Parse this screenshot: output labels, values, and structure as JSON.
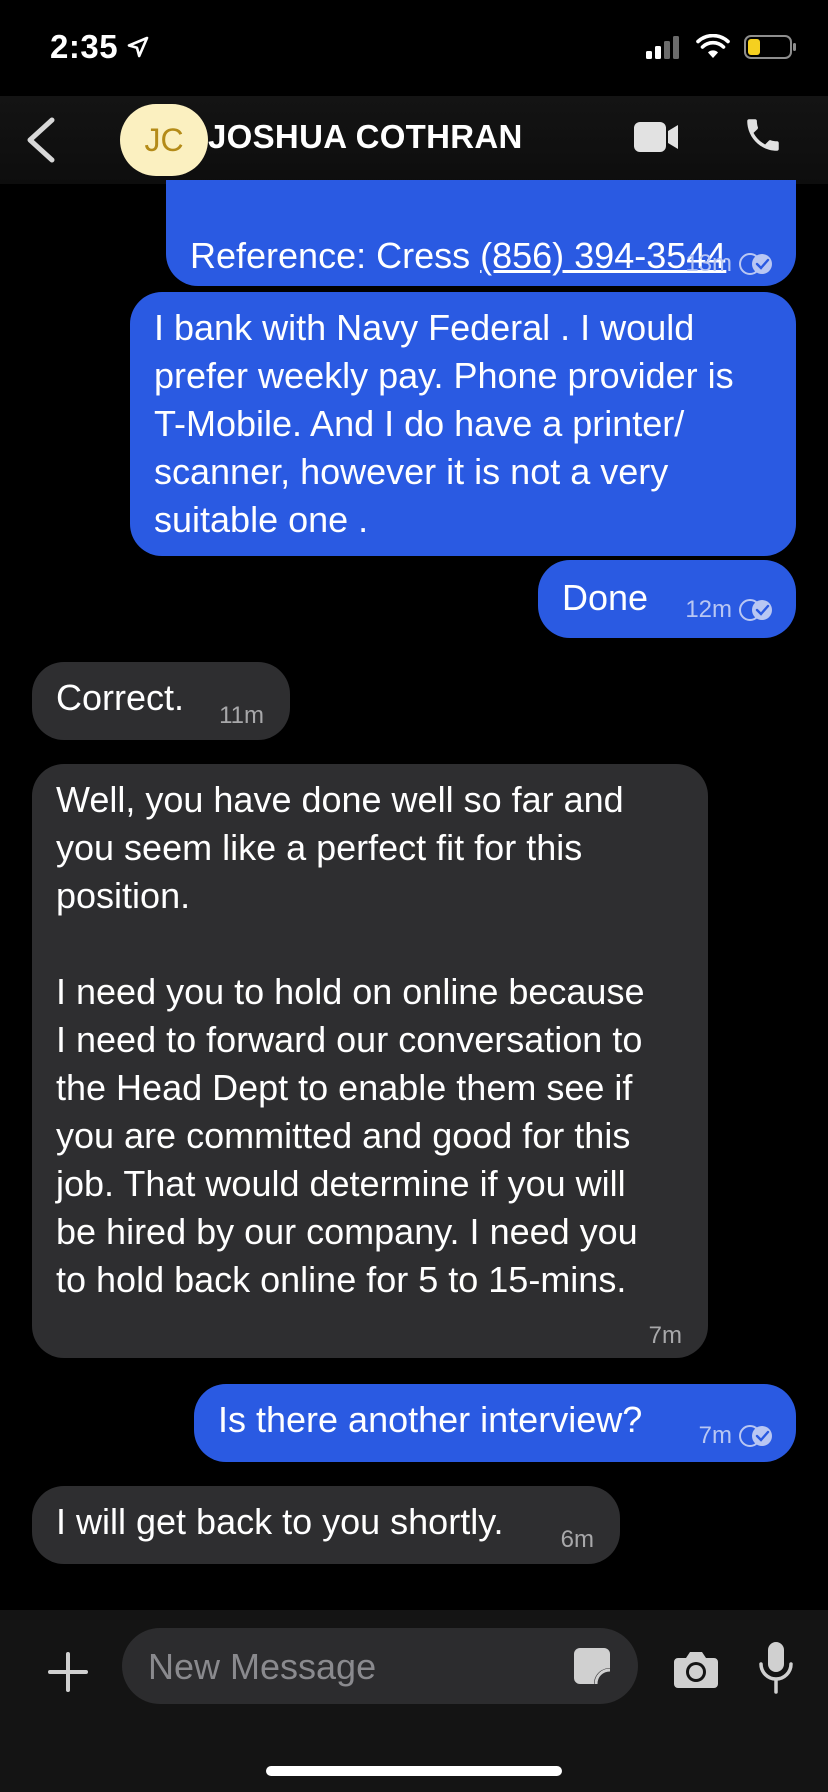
{
  "status_bar": {
    "time": "2:35"
  },
  "header": {
    "avatar_initials": "JC",
    "contact_name": "JOSHUA COTHRAN"
  },
  "messages": [
    {
      "direction": "out",
      "text": "Reference: Cress ",
      "link": "(856) 394-3544",
      "time": "13m",
      "read": true
    },
    {
      "direction": "out",
      "text": "I bank with Navy Federal . I would\nprefer weekly pay. Phone provider is\nT-Mobile. And I do have a printer/\nscanner, however it is not a very\nsuitable one .",
      "read": true
    },
    {
      "direction": "out",
      "text": "Done",
      "time": "12m",
      "read": true
    },
    {
      "direction": "in",
      "text": "Correct.",
      "time": "11m"
    },
    {
      "direction": "in",
      "text": "Well, you have done well so far and\nyou seem like a perfect fit for this\nposition.\n\nI need you to hold on online because\nI need to forward our conversation to\nthe Head Dept to enable them see if\nyou are committed and good for this\njob. That would determine if you will\nbe hired by our company. I need you\nto hold back online for 5 to 15-mins.",
      "time": "7m"
    },
    {
      "direction": "out",
      "text": "Is there another interview?",
      "time": "7m",
      "read": true
    },
    {
      "direction": "in",
      "text": "I will get back to you shortly.",
      "time": "6m"
    }
  ],
  "composer": {
    "placeholder": "New Message"
  },
  "colors": {
    "outgoing": "#2a5ae2",
    "incoming": "#2e2e30",
    "avatar_bg": "#fbf0c0",
    "battery": "#f5d020"
  }
}
